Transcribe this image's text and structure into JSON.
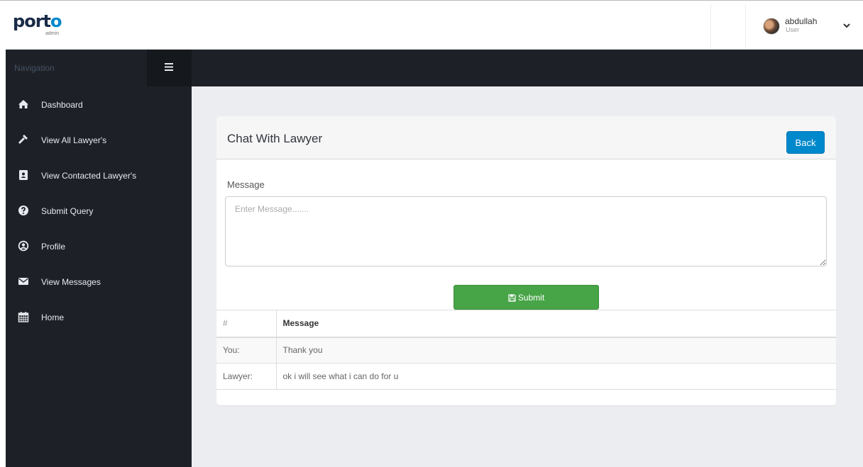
{
  "header": {
    "logo_text": "porto",
    "logo_sub": "admin",
    "user_name": "abdullah",
    "user_role": "User"
  },
  "sidebar": {
    "title": "Navigation",
    "items": [
      {
        "label": "Dashboard",
        "icon": "home-icon"
      },
      {
        "label": "View All Lawyer's",
        "icon": "gavel-icon"
      },
      {
        "label": "View Contacted Lawyer's",
        "icon": "address-book-icon"
      },
      {
        "label": "Submit Query",
        "icon": "question-circle-icon"
      },
      {
        "label": "Profile",
        "icon": "user-circle-icon"
      },
      {
        "label": "View Messages",
        "icon": "envelope-icon"
      },
      {
        "label": "Home",
        "icon": "calendar-icon"
      }
    ]
  },
  "panel": {
    "title": "Chat With Lawyer",
    "back_label": "Back",
    "message_label": "Message",
    "message_placeholder": "Enter Message.......",
    "submit_label": "Submit"
  },
  "table": {
    "headers": [
      "#",
      "Message"
    ],
    "rows": [
      {
        "sender": "You:",
        "message": "Thank you"
      },
      {
        "sender": "Lawyer:",
        "message": "ok i will see what i can do for u"
      }
    ]
  },
  "colors": {
    "sidebar_bg": "#1d2127",
    "primary": "#0088cc",
    "success": "#47a447",
    "page_bg": "#ecedf0"
  }
}
